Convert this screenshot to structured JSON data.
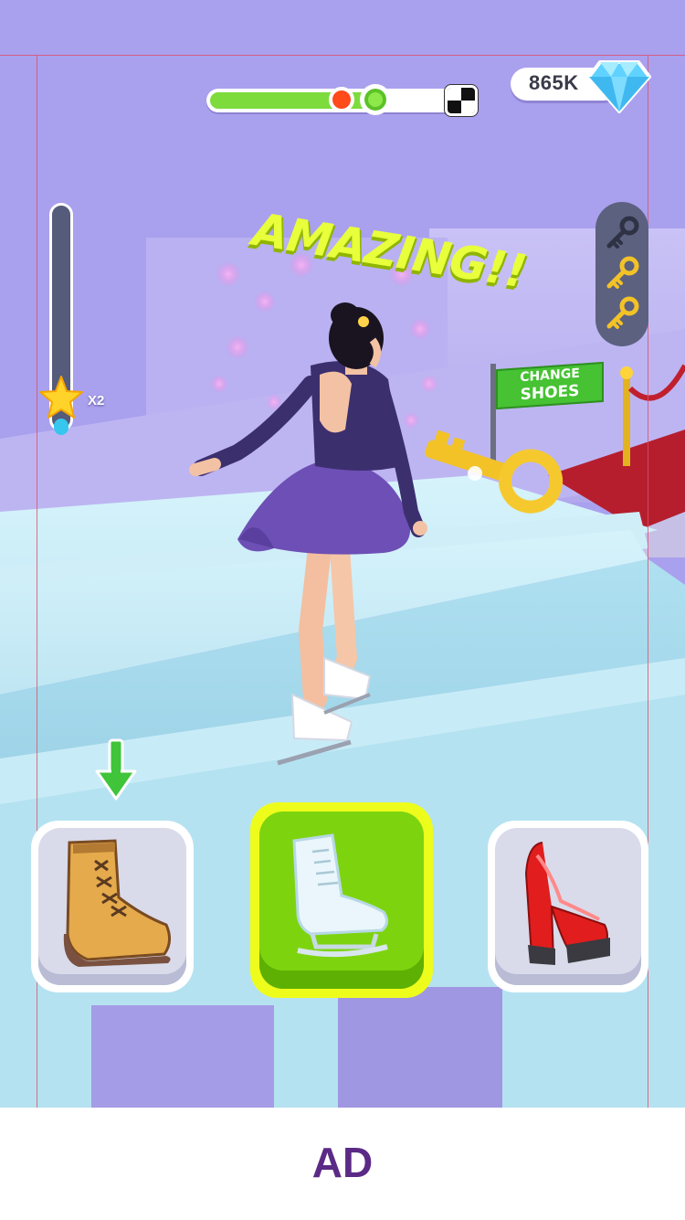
{
  "hud": {
    "gems_count": "865K",
    "level_progress": 0.66,
    "checkpoint_progress": 0.53,
    "multiplier_label": "X2",
    "multiplier_fill": 0.05,
    "keys_total": 3,
    "keys_collected": 2
  },
  "popup": {
    "text": "AMAZING!!"
  },
  "sign": {
    "line1": "CHANGE",
    "line2": "SHOES"
  },
  "shoe_options": [
    {
      "name": "boot",
      "icon": "boot-icon",
      "selected": false
    },
    {
      "name": "ice skate",
      "icon": "ice-skate-icon",
      "selected": true
    },
    {
      "name": "high heels",
      "icon": "high-heel-icon",
      "selected": false
    }
  ],
  "ad": {
    "label": "AD"
  },
  "colors": {
    "sky": "#a9a0ee",
    "progress_fill": "#7ddc3c",
    "popup_text": "#e8ff3c",
    "selected_button": "#7dd40e",
    "ad_text": "#5b2a86"
  }
}
